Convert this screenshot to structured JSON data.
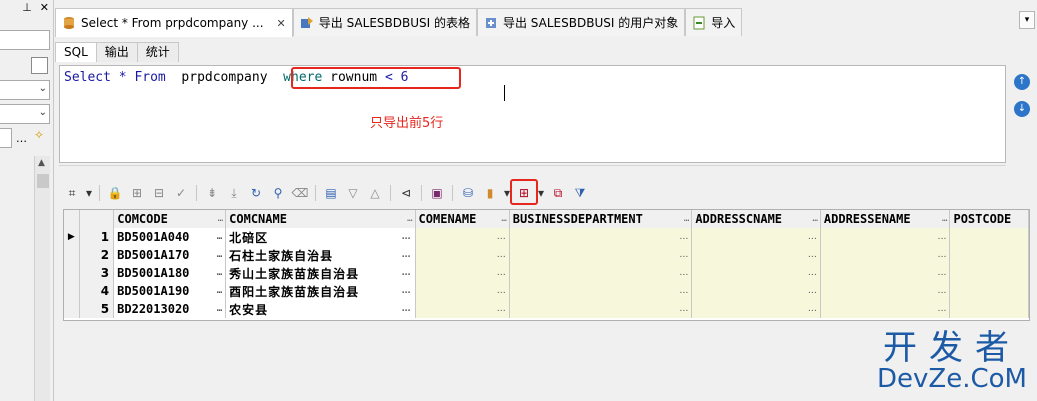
{
  "tabs": [
    {
      "label": "Select * From prpdcompany ...",
      "active": true,
      "closable": true
    },
    {
      "label": "导出 SALESBDBUSI 的表格",
      "active": false
    },
    {
      "label": "导出 SALESBDBUSI 的用户对象",
      "active": false
    },
    {
      "label": "导入",
      "active": false
    }
  ],
  "subtabs": [
    "SQL",
    "输出",
    "统计"
  ],
  "editor": {
    "kw_select": "Select",
    "star": "*",
    "kw_from": "From",
    "table": "prpdcompany",
    "kw_where": "where",
    "col": "rownum",
    "op": "<",
    "num": "6",
    "annotation": "只导出前5行"
  },
  "grid": {
    "columns": [
      "COMCODE",
      "COMCNAME",
      "COMENAME",
      "BUSINESSDEPARTMENT",
      "ADDRESSCNAME",
      "ADDRESSENAME",
      "POSTCODE"
    ],
    "rows": [
      {
        "n": "1",
        "code": "BD5001A040",
        "name": "北碚区"
      },
      {
        "n": "2",
        "code": "BD5001A170",
        "name": "石柱土家族自治县"
      },
      {
        "n": "3",
        "code": "BD5001A180",
        "name": "秀山土家族苗族自治县"
      },
      {
        "n": "4",
        "code": "BD5001A190",
        "name": "酉阳土家族苗族自治县"
      },
      {
        "n": "5",
        "code": "BD22013020",
        "name": "农安县"
      }
    ]
  },
  "watermark": {
    "line1": "开发者",
    "line2": "DevZe.CoM"
  },
  "colors": {
    "accent_red": "#e5271e",
    "keyword_blue": "#1a1aa6",
    "cell_yellow": "#f7f7dc"
  }
}
